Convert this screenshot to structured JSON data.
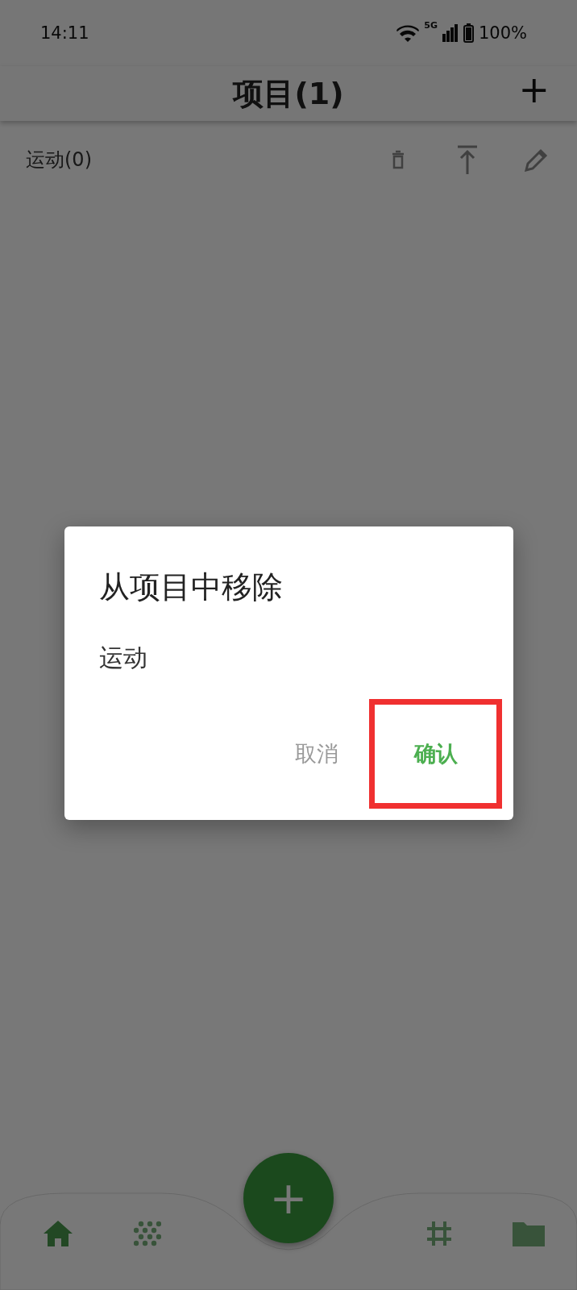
{
  "status_bar": {
    "time": "14:11",
    "network": "5G",
    "battery": "100%"
  },
  "app_bar": {
    "title": "项目(1)",
    "add": "+"
  },
  "projects": [
    {
      "name": "运动(0)"
    }
  ],
  "dialog": {
    "title": "从项目中移除",
    "message": "运动",
    "buttons": [
      {
        "label": "取消",
        "kind": "cancel",
        "highlighted": false
      },
      {
        "label": "确认",
        "kind": "confirm",
        "highlighted": true
      }
    ]
  },
  "fab": {
    "label": "+"
  },
  "nav": [
    {
      "kind": "home",
      "selected": true
    },
    {
      "kind": "dots",
      "selected": false
    },
    {
      "kind": "hash",
      "selected": false
    },
    {
      "kind": "folder",
      "selected": false
    }
  ]
}
